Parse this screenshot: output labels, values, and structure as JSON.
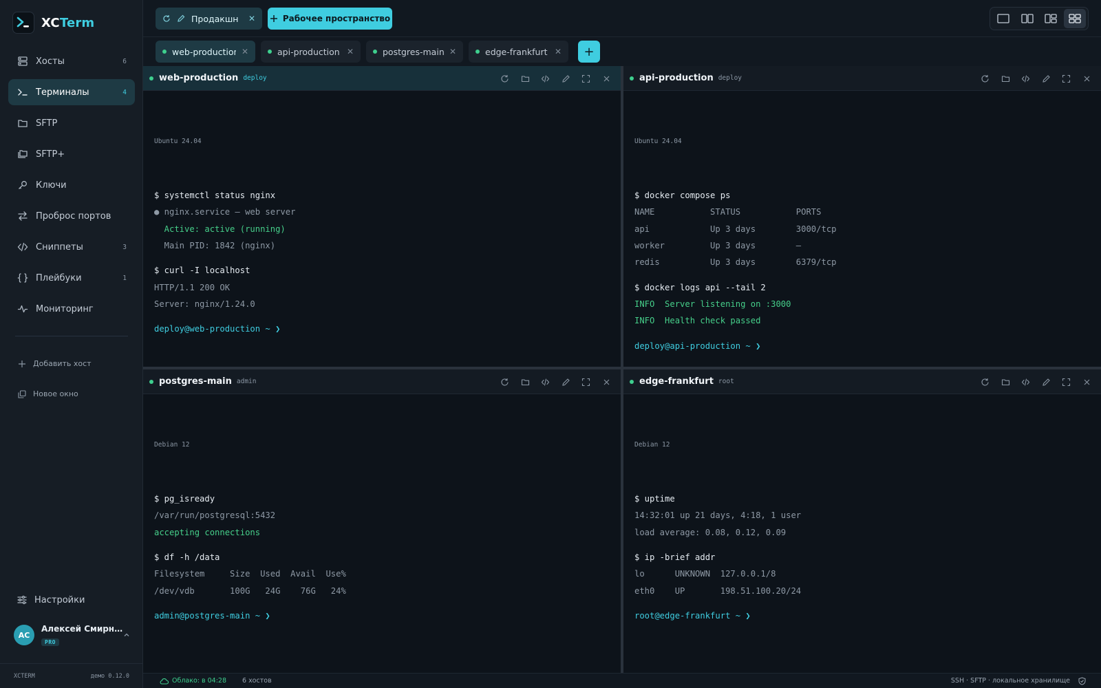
{
  "app": {
    "name_part1": "XC",
    "name_part2": "Term"
  },
  "sidebar": {
    "items": [
      {
        "label": "Хосты",
        "count": "6",
        "icon": "server-icon"
      },
      {
        "label": "Терминалы",
        "count": "4",
        "icon": "terminal-icon"
      },
      {
        "label": "SFTP",
        "count": "",
        "icon": "folder-icon"
      },
      {
        "label": "SFTP+",
        "count": "",
        "icon": "folders-icon"
      },
      {
        "label": "Ключи",
        "count": "",
        "icon": "key-icon"
      },
      {
        "label": "Проброс портов",
        "count": "",
        "icon": "arrows-icon"
      },
      {
        "label": "Сниппеты",
        "count": "3",
        "icon": "code-icon"
      },
      {
        "label": "Плейбуки",
        "count": "1",
        "icon": "braces-icon"
      },
      {
        "label": "Мониторинг",
        "count": "",
        "icon": "activity-icon"
      }
    ],
    "add_host": "Добавить хост",
    "new_window": "Новое окно",
    "settings": "Настройки",
    "user": {
      "initials": "АС",
      "name": "Алексей Смирн…",
      "plan": "PRO"
    },
    "footer_left": "XCTERM",
    "footer_right": "демо 0.12.0"
  },
  "topbar": {
    "workspace_tab": "Продакшн",
    "add_workspace": "Рабочее пространство"
  },
  "tabs": [
    {
      "label": "web-production"
    },
    {
      "label": "api-production"
    },
    {
      "label": "postgres-main"
    },
    {
      "label": "edge-frankfurt"
    }
  ],
  "panes": [
    {
      "title": "web-production",
      "user": "deploy",
      "os": "Ubuntu 24.04",
      "lines": [
        {
          "t": "$ systemctl status nginx",
          "k": "cmd"
        },
        {
          "t": "● nginx.service — web server",
          "k": "out"
        },
        {
          "t": "  Active: active (running)",
          "k": "ok"
        },
        {
          "t": "  Main PID: 1842 (nginx)",
          "k": "out"
        },
        {
          "t": "",
          "k": "blank"
        },
        {
          "t": "$ curl -I localhost",
          "k": "cmd"
        },
        {
          "t": "HTTP/1.1 200 OK",
          "k": "out"
        },
        {
          "t": "Server: nginx/1.24.0",
          "k": "out"
        },
        {
          "t": "",
          "k": "blank"
        },
        {
          "t": "deploy@web-production ~ ❯",
          "k": "prompt"
        }
      ]
    },
    {
      "title": "api-production",
      "user": "deploy",
      "os": "Ubuntu 24.04",
      "lines": [
        {
          "t": "$ docker compose ps",
          "k": "cmd"
        },
        {
          "t": "NAME           STATUS           PORTS",
          "k": "out"
        },
        {
          "t": "api            Up 3 days        3000/tcp",
          "k": "out"
        },
        {
          "t": "worker         Up 3 days        —",
          "k": "out"
        },
        {
          "t": "redis          Up 3 days        6379/tcp",
          "k": "out"
        },
        {
          "t": "",
          "k": "blank"
        },
        {
          "t": "$ docker logs api --tail 2",
          "k": "cmd"
        },
        {
          "t": "INFO  Server listening on :3000",
          "k": "ok"
        },
        {
          "t": "INFO  Health check passed",
          "k": "ok"
        },
        {
          "t": "",
          "k": "blank"
        },
        {
          "t": "deploy@api-production ~ ❯",
          "k": "prompt"
        }
      ]
    },
    {
      "title": "postgres-main",
      "user": "admin",
      "os": "Debian 12",
      "lines": [
        {
          "t": "$ pg_isready",
          "k": "cmd"
        },
        {
          "t": "/var/run/postgresql:5432",
          "k": "out"
        },
        {
          "t": "accepting connections",
          "k": "ok"
        },
        {
          "t": "",
          "k": "blank"
        },
        {
          "t": "$ df -h /data",
          "k": "cmd"
        },
        {
          "t": "Filesystem     Size  Used  Avail  Use%",
          "k": "out"
        },
        {
          "t": "/dev/vdb       100G   24G    76G   24%",
          "k": "out"
        },
        {
          "t": "",
          "k": "blank"
        },
        {
          "t": "admin@postgres-main ~ ❯",
          "k": "prompt"
        }
      ]
    },
    {
      "title": "edge-frankfurt",
      "user": "root",
      "os": "Debian 12",
      "lines": [
        {
          "t": "$ uptime",
          "k": "cmd"
        },
        {
          "t": "14:32:01 up 21 days, 4:18, 1 user",
          "k": "out"
        },
        {
          "t": "load average: 0.08, 0.12, 0.09",
          "k": "out"
        },
        {
          "t": "",
          "k": "blank"
        },
        {
          "t": "$ ip -brief addr",
          "k": "cmd"
        },
        {
          "t": "lo      UNKNOWN  127.0.0.1/8",
          "k": "out"
        },
        {
          "t": "eth0    UP       198.51.100.20/24",
          "k": "out"
        },
        {
          "t": "",
          "k": "blank"
        },
        {
          "t": "root@edge-frankfurt ~ ❯",
          "k": "prompt"
        }
      ]
    }
  ],
  "statusbar": {
    "cloud": "Облако: в 04:28",
    "hosts": "6 хостов",
    "right": "SSH · SFTP · локальное хранилище"
  },
  "colors": {
    "accent": "#3fcde0",
    "ok": "#3ecf8e",
    "bg": "#0d131a",
    "sidebar": "#161d25"
  }
}
